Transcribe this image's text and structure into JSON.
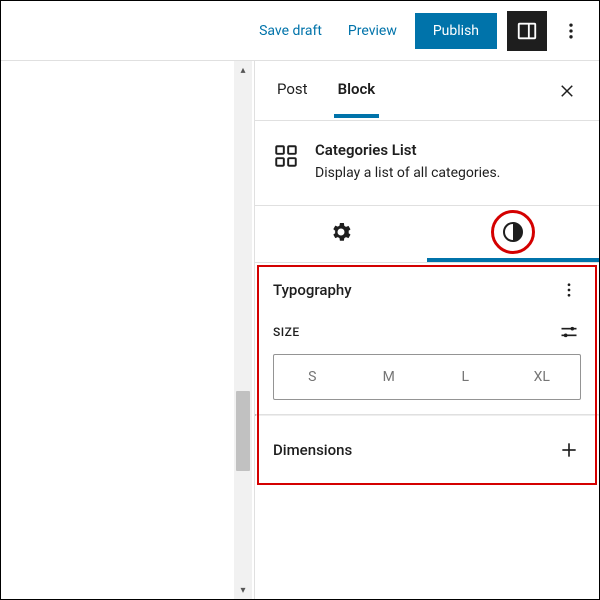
{
  "topbar": {
    "save_draft": "Save draft",
    "preview": "Preview",
    "publish": "Publish"
  },
  "sidebar": {
    "tabs": {
      "post": "Post",
      "block": "Block"
    },
    "block": {
      "title": "Categories List",
      "description": "Display a list of all categories."
    },
    "typography": {
      "title": "Typography",
      "size_label": "SIZE",
      "sizes": [
        "S",
        "M",
        "L",
        "XL"
      ]
    },
    "dimensions": {
      "title": "Dimensions"
    }
  }
}
